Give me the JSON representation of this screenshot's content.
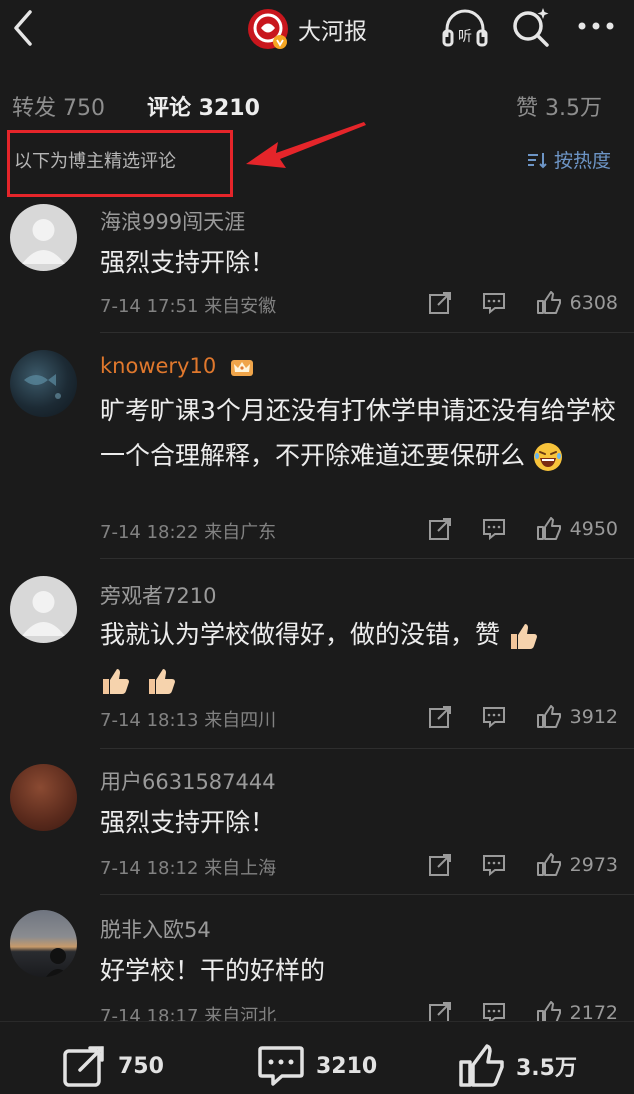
{
  "header": {
    "brand_name": "大河报"
  },
  "stats": {
    "reposts_label": "转发 750",
    "comments_label": "评论 3210",
    "likes_label": "赞 3.5万"
  },
  "subheader": {
    "selected_note": "以下为博主精选评论",
    "sort_label": "按热度"
  },
  "comments": [
    {
      "name": "海浪999闯天涯",
      "text": "强烈支持开除！",
      "time": "7-14 17:51",
      "location": "来自安徽",
      "likes": "6308"
    },
    {
      "name": "knowery10",
      "text": "旷考旷课3个月还没有打休学申请还没有给学校一个合理解释，不开除难道还要保研么",
      "time": "7-14 18:22",
      "location": "来自广东",
      "likes": "4950"
    },
    {
      "name": "旁观者7210",
      "text": "我就认为学校做得好，做的没错，赞",
      "time": "7-14 18:13",
      "location": "来自四川",
      "likes": "3912"
    },
    {
      "name": "用户6631587444",
      "text": "强烈支持开除！",
      "time": "7-14 18:12",
      "location": "来自上海",
      "likes": "2973"
    },
    {
      "name": "脱非入欧54",
      "text": "好学校！干的好样的",
      "time": "7-14 18:17",
      "location": "来自河北",
      "likes": "2172"
    }
  ],
  "bottom_bar": {
    "reposts": "750",
    "comments": "3210",
    "likes": "3.5万"
  }
}
